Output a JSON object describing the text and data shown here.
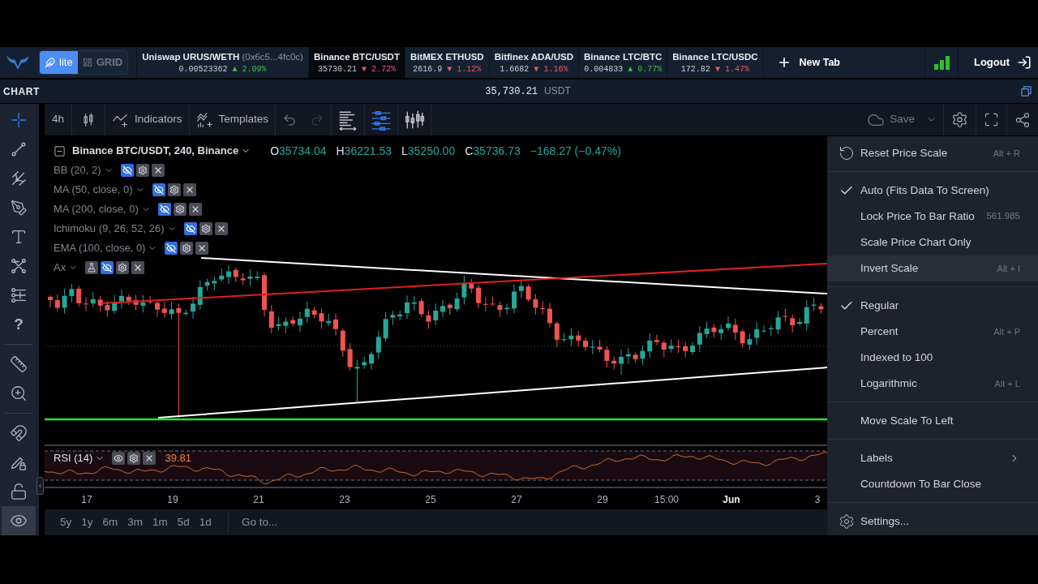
{
  "header": {
    "modes": [
      {
        "label": "lite",
        "selected": true
      },
      {
        "label": "GRID",
        "selected": false
      }
    ],
    "tabs": [
      {
        "title": "Uniswap URUS/WETH",
        "title_note": "(0x6c5...4fc0c)",
        "price": "0.00523362",
        "arrow": "▲",
        "change": "2.09%",
        "color": "#3fbf55",
        "selected": false
      },
      {
        "title": "Binance BTC/USDT",
        "price": "35730.21",
        "arrow": "▼",
        "change": "2.72%",
        "color": "#ea5a6d",
        "selected": true
      },
      {
        "title": "BitMEX ETHUSD",
        "price": "2616.9",
        "arrow": "▼",
        "change": "1.12%",
        "color": "#ea5a6d",
        "selected": false
      },
      {
        "title": "Bitfinex ADA/USD",
        "price": "1.6682",
        "arrow": "▼",
        "change": "1.16%",
        "color": "#ea5a6d",
        "selected": false
      },
      {
        "title": "Binance LTC/BTC",
        "price": "0.004833",
        "arrow": "▲",
        "change": "0.77%",
        "color": "#3fbf55",
        "selected": false
      },
      {
        "title": "Binance LTC/USDC",
        "price": "172.82",
        "arrow": "▼",
        "change": "1.47%",
        "color": "#ea5a6d",
        "selected": false
      }
    ],
    "new_tab": "New Tab",
    "logout": "Logout"
  },
  "chart_bar": {
    "title": "CHART",
    "price": "35,730.21",
    "currency": "USDT"
  },
  "tools": [
    {
      "selected": true,
      "hovered": false
    },
    {
      "selected": false,
      "hovered": false
    },
    {
      "selected": false,
      "hovered": false
    },
    {
      "selected": false,
      "hovered": false
    },
    {
      "selected": false,
      "hovered": false
    },
    {
      "selected": false,
      "hovered": false
    },
    {
      "selected": false,
      "hovered": false
    },
    {
      "glyph": "?",
      "selected": false,
      "hovered": false
    },
    {
      "selected": false,
      "hovered": false
    },
    {
      "selected": false,
      "hovered": false
    },
    {
      "selected": false,
      "hovered": false
    },
    {
      "selected": false,
      "hovered": false
    },
    {
      "selected": false,
      "hovered": false
    },
    {
      "selected": false,
      "hovered": true
    }
  ],
  "toolbar": {
    "interval": "4h",
    "indicators": "Indicators",
    "templates": "Templates",
    "undo": {
      "disabled": false
    },
    "redo": {
      "disabled": true
    },
    "layouts": [
      {
        "selected": false
      },
      {
        "selected": true
      },
      {
        "selected": false
      }
    ],
    "save": "Save"
  },
  "legend": {
    "symbol": "Binance BTC/USDT, 240, Binance",
    "ohlc": [
      {
        "label": "O",
        "value": "35734.04"
      },
      {
        "label": "H",
        "value": "36221.53"
      },
      {
        "label": "L",
        "value": "35250.00"
      },
      {
        "label": "C",
        "value": "35736.73"
      }
    ],
    "change": "−168.27 (−0.47%)"
  },
  "studies": [
    {
      "name": "BB (20, 2)",
      "kind": "study",
      "hidden": true
    },
    {
      "name": "MA (50, close, 0)",
      "kind": "study",
      "hidden": true
    },
    {
      "name": "MA (200, close, 0)",
      "kind": "study",
      "hidden": true
    },
    {
      "name": "Ichimoku (9, 26, 52, 26)",
      "kind": "study",
      "hidden": true
    },
    {
      "name": "EMA (100, close, 0)",
      "kind": "study",
      "hidden": true
    },
    {
      "name": "Ax",
      "kind": "script",
      "hidden": true
    }
  ],
  "rsi": {
    "name": "RSI (14)",
    "hidden": false,
    "value": "39.81"
  },
  "time_axis": [
    {
      "label": "17",
      "major": false
    },
    {
      "label": "19",
      "major": false
    },
    {
      "label": "21",
      "major": false
    },
    {
      "label": "23",
      "major": false
    },
    {
      "label": "25",
      "major": false
    },
    {
      "label": "27",
      "major": false
    },
    {
      "label": "29",
      "major": false
    },
    {
      "label": "15:00",
      "major": false
    },
    {
      "label": "Jun",
      "major": true
    },
    {
      "label": "3",
      "major": false
    }
  ],
  "ranges": [
    "5y",
    "1y",
    "6m",
    "3m",
    "1m",
    "5d",
    "1d"
  ],
  "goto": "Go to...",
  "menu": {
    "sections": [
      {
        "items": [
          {
            "kind": "reset",
            "label": "Reset Price Scale",
            "shortcut": "Alt + R",
            "highlighted": false
          }
        ]
      },
      {
        "items": [
          {
            "kind": "toggle",
            "label": "Auto (Fits Data To Screen)",
            "checked": true,
            "highlighted": false
          },
          {
            "kind": "toggle",
            "label": "Lock Price To Bar Ratio",
            "value": "561.985",
            "checked": false,
            "highlighted": false
          },
          {
            "kind": "toggle",
            "label": "Scale Price Chart Only",
            "checked": false,
            "highlighted": false
          },
          {
            "kind": "toggle",
            "label": "Invert Scale",
            "shortcut": "Alt + I",
            "checked": false,
            "highlighted": true
          }
        ]
      },
      {
        "items": [
          {
            "kind": "radio",
            "label": "Regular",
            "selected": true,
            "highlighted": false
          },
          {
            "kind": "radio",
            "label": "Percent",
            "shortcut": "Alt + P",
            "selected": false,
            "highlighted": false
          },
          {
            "kind": "radio",
            "label": "Indexed to 100",
            "selected": false,
            "highlighted": false
          },
          {
            "kind": "radio",
            "label": "Logarithmic",
            "shortcut": "Alt + L",
            "selected": false,
            "highlighted": false
          }
        ]
      },
      {
        "items": [
          {
            "kind": "action",
            "label": "Move Scale To Left",
            "highlighted": false
          }
        ]
      },
      {
        "items": [
          {
            "kind": "submenu",
            "label": "Labels",
            "highlighted": false
          },
          {
            "kind": "toggle",
            "label": "Countdown To Bar Close",
            "checked": false,
            "highlighted": false
          }
        ]
      },
      {
        "items": [
          {
            "kind": "settings",
            "label": "Settings...",
            "highlighted": false
          }
        ]
      }
    ]
  }
}
